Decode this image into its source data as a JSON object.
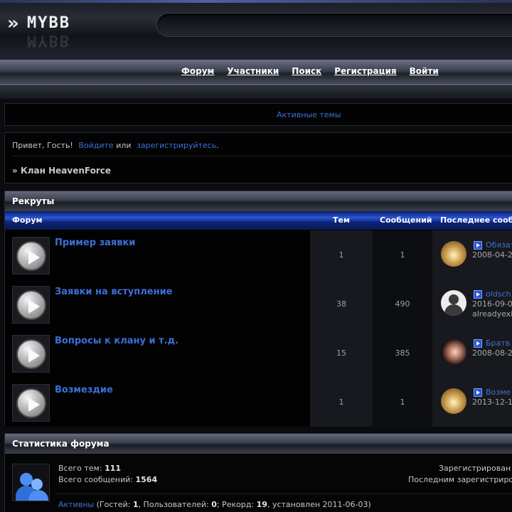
{
  "header": {
    "logo_chevron": "»",
    "logo_text": "MYBB"
  },
  "menu": {
    "items": [
      "Форум",
      "Участники",
      "Поиск",
      "Регистрация",
      "Войти"
    ]
  },
  "active_topics": {
    "label": "Активные темы"
  },
  "welcome": {
    "greeting": "Привет, Гость!",
    "login_link": "Войдите",
    "or": "или",
    "register_link": "зарегистрируйтесь",
    "end": "."
  },
  "breadcrumb": {
    "text": "» Клан HeavenForce"
  },
  "forum_category": {
    "title": "Рекруты",
    "columns": {
      "forum": "Форум",
      "threads": "Тем",
      "posts": "Сообщений",
      "last_post": "Последнее сооб"
    },
    "rows": [
      {
        "title": "Пример заявки",
        "threads": "1",
        "posts": "1",
        "last_link": "Обязат",
        "last_date": "2008-04-2",
        "last_user": "",
        "avatar": "light"
      },
      {
        "title": "Заявки на вступление",
        "threads": "38",
        "posts": "490",
        "last_link": "oldsch",
        "last_date": "2016-09-0",
        "last_user": "alreadyexi",
        "avatar": "default"
      },
      {
        "title": "Вопросы к клану и т.д.",
        "threads": "15",
        "posts": "385",
        "last_link": "Братв",
        "last_date": "2008-08-2",
        "last_user": "",
        "avatar": "anime"
      },
      {
        "title": "Возмездие",
        "threads": "1",
        "posts": "1",
        "last_link": "Возме",
        "last_date": "2013-12-1",
        "last_user": "",
        "avatar": "light"
      }
    ]
  },
  "stats": {
    "title": "Статистика форума",
    "total_topics_label": "Всего тем:",
    "total_topics": "111",
    "total_posts_label": "Всего сообщений:",
    "total_posts": "1564",
    "registered_label": "Зарегистрирован",
    "last_registered_label": "Последним зарегистриро",
    "active_link": "Активны",
    "active_open": "(Гостей:",
    "guests": "1",
    "users_label": ", Пользователей:",
    "users": "0",
    "record_label": "; Рекорд:",
    "record": "19",
    "set_label": ", установлен 2011-06-03)"
  }
}
